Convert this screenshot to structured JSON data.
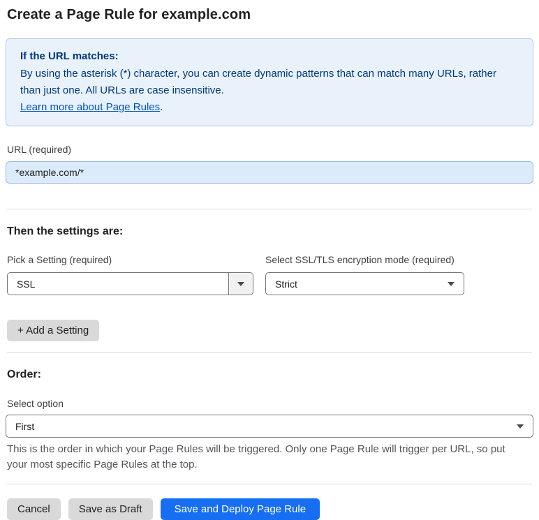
{
  "page": {
    "title": "Create a Page Rule for example.com"
  },
  "info_box": {
    "heading": "If the URL matches:",
    "body": "By using the asterisk (*) character, you can create dynamic patterns that can match many URLs, rather than just one. All URLs are case insensitive.",
    "link_label": "Learn more about Page Rules",
    "link_suffix": "."
  },
  "url_field": {
    "label": "URL (required)",
    "value": "*example.com/*"
  },
  "settings": {
    "heading": "Then the settings are:",
    "setting_select": {
      "label": "Pick a Setting (required)",
      "value": "SSL"
    },
    "mode_select": {
      "label": "Select SSL/TLS encryption mode (required)",
      "value": "Strict"
    },
    "add_button_label": "+ Add a Setting"
  },
  "order": {
    "heading": "Order:",
    "select_label": "Select option",
    "value": "First",
    "helper": "This is the order in which your Page Rules will be triggered. Only one Page Rule will trigger per URL, so put your most specific Page Rules at the top."
  },
  "footer": {
    "cancel_label": "Cancel",
    "save_draft_label": "Save as Draft",
    "save_deploy_label": "Save and Deploy Page Rule"
  },
  "icons": {
    "dropdown_arrow": "caret-down"
  },
  "colors": {
    "primary_button_blue": "#166ef2",
    "info_box_background": "#e9f2fb",
    "info_box_border": "#abc9e9",
    "info_box_text": "#003681",
    "link_blue": "#0051c3",
    "url_input_background": "#dcebfb",
    "secondary_button_gray": "#d9d9d9",
    "divider_gray": "#dcdcdc"
  }
}
